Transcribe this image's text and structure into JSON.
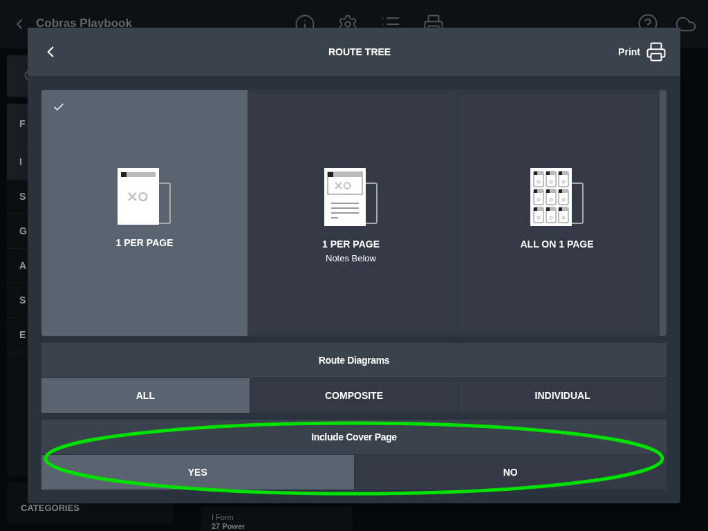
{
  "background": {
    "app_title": "Cobras Playbook",
    "sidebar": {
      "header": "F",
      "items": [
        {
          "label": "I",
          "selected": true
        },
        {
          "label": "S",
          "selected": false
        },
        {
          "label": "G",
          "selected": false
        },
        {
          "label": "A",
          "selected": false
        },
        {
          "label": "S",
          "selected": false
        },
        {
          "label": "E",
          "selected": false
        }
      ]
    },
    "categories": "CATEGORIES",
    "play_card": {
      "formation": "I Form",
      "name": "27 Power"
    }
  },
  "dialog": {
    "title": "ROUTE TREE",
    "print_label": "Print",
    "layouts": [
      {
        "kind": "single",
        "label": "1 PER PAGE",
        "selected": true
      },
      {
        "kind": "notes",
        "label": "1 PER PAGE",
        "sublabel": "Notes Below",
        "selected": false
      },
      {
        "kind": "grid",
        "label": "ALL ON 1 PAGE",
        "selected": false
      }
    ],
    "sections": [
      {
        "title": "Route Diagrams",
        "options": [
          {
            "label": "ALL",
            "selected": true
          },
          {
            "label": "COMPOSITE",
            "selected": false
          },
          {
            "label": "INDIVIDUAL",
            "selected": false
          }
        ]
      },
      {
        "title": "Include Cover Page",
        "highlighted": true,
        "options": [
          {
            "label": "YES",
            "selected": true
          },
          {
            "label": "NO",
            "selected": false
          }
        ]
      }
    ]
  }
}
